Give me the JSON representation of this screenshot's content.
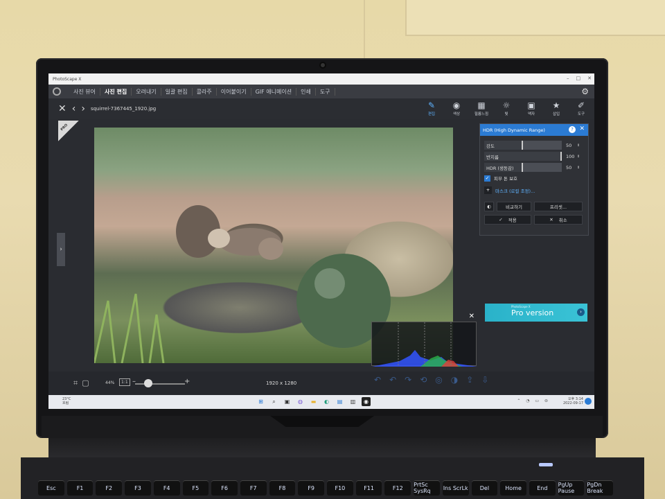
{
  "app": {
    "title": "PhotoScape X",
    "menu": [
      "사진 뷰어",
      "사진 편집",
      "오려내기",
      "일괄 편집",
      "콜라주",
      "이어붙이기",
      "GIF 애니메이션",
      "인쇄",
      "도구"
    ],
    "active_menu": "사진 편집"
  },
  "file": {
    "name": "squirrel-7367445_1920.jpg"
  },
  "tools": [
    {
      "label": "편집",
      "icon": "edit-icon",
      "glyph": "✎"
    },
    {
      "label": "색상",
      "icon": "color-icon",
      "glyph": "◉"
    },
    {
      "label": "필름느낌",
      "icon": "film-icon",
      "glyph": "▦"
    },
    {
      "label": "빛",
      "icon": "light-icon",
      "glyph": "☼"
    },
    {
      "label": "액자",
      "icon": "frame-icon",
      "glyph": "▣"
    },
    {
      "label": "삽입",
      "icon": "insert-icon",
      "glyph": "★"
    },
    {
      "label": "도구",
      "icon": "tool-icon",
      "glyph": "✐"
    }
  ],
  "hdr": {
    "title": "HDR (High Dynamic Range)",
    "sliders": [
      {
        "label": "강도",
        "value": "50",
        "fraction": 0.5
      },
      {
        "label": "반지름",
        "value": "100",
        "fraction": 1.0
      },
      {
        "label": "HDR (생동감)",
        "value": "50",
        "fraction": 0.5
      }
    ],
    "skin_protect": "피부 톤 보호",
    "mask": "마스크 (로컬 조정)...",
    "compare": "비교하기",
    "preset": "프리셋...",
    "apply": "적용",
    "cancel": "취소"
  },
  "pro": {
    "small": "PhotoScape X",
    "label": "Pro version"
  },
  "ribbon": "PRO",
  "bottom": {
    "zoom": "44%",
    "one_to_one": "1:1",
    "dimensions": "1920 x 1280"
  },
  "taskbar": {
    "weather_temp": "23°C",
    "weather_text": "흐림",
    "time": "오후 3:14",
    "date": "2022-09-17"
  },
  "keys": [
    "Esc",
    "F1",
    "F2",
    "F3",
    "F4",
    "F5",
    "F6",
    "F7",
    "F8",
    "F9",
    "F10",
    "F11",
    "F12",
    "PrtSc SysRq",
    "Ins ScrLk",
    "Del",
    "Home",
    "End",
    "PgUp Pause",
    "PgDn Break"
  ],
  "colors": {
    "accent": "#2b7bd3",
    "pro_banner": "#2ab2c9"
  }
}
